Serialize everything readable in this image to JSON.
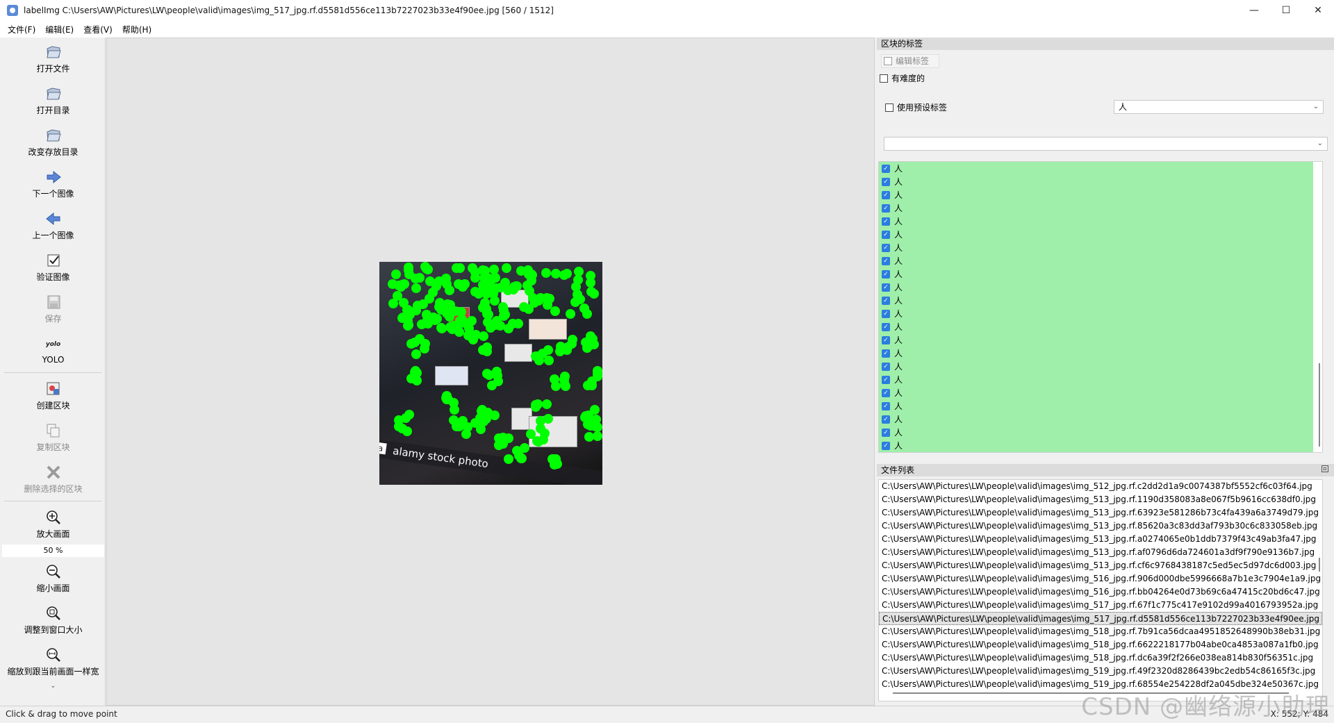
{
  "window": {
    "title": "labelImg C:\\Users\\AW\\Pictures\\LW\\people\\valid\\images\\img_517_jpg.rf.d5581d556ce113b7227023b33e4f90ee.jpg [560 / 1512]",
    "controls": {
      "minimize": "—",
      "maximize": "☐",
      "close": "✕"
    }
  },
  "menu": [
    "文件(F)",
    "编辑(E)",
    "查看(V)",
    "帮助(H)"
  ],
  "toolbar": {
    "open_file": "打开文件",
    "open_dir": "打开目录",
    "change_save_dir": "改变存放目录",
    "next_image": "下一个图像",
    "prev_image": "上一个图像",
    "verify_image": "验证图像",
    "save": "保存",
    "format_icon": "yolo",
    "format": "YOLO",
    "create_box": "创建区块",
    "duplicate_box": "复制区块",
    "delete_box": "删除选择的区块",
    "zoom_in": "放大画面",
    "zoom_value": "50 %",
    "zoom_out": "缩小画面",
    "fit_window": "调整到窗口大小",
    "fit_width": "缩放到跟当前画面一样宽",
    "more": "⌄"
  },
  "canvas": {
    "watermark_mark": "a",
    "watermark_text": "alamy stock photo"
  },
  "box_labels_dock": {
    "title": "区块的标签",
    "edit_label": "编辑标签",
    "difficult": "有难度的",
    "use_default_label": "使用预设标签",
    "default_label_value": "人",
    "label_filter_value": "",
    "label_items": [
      "人",
      "人",
      "人",
      "人",
      "人",
      "人",
      "人",
      "人",
      "人",
      "人",
      "人",
      "人",
      "人",
      "人",
      "人",
      "人",
      "人",
      "人",
      "人",
      "人",
      "人",
      "人"
    ]
  },
  "file_list_dock": {
    "title": "文件列表",
    "files": [
      "C:\\Users\\AW\\Pictures\\LW\\people\\valid\\images\\img_512_jpg.rf.c2dd2d1a9c0074387bf5552cf6c03f64.jpg",
      "C:\\Users\\AW\\Pictures\\LW\\people\\valid\\images\\img_513_jpg.rf.1190d358083a8e067f5b9616cc638df0.jpg",
      "C:\\Users\\AW\\Pictures\\LW\\people\\valid\\images\\img_513_jpg.rf.63923e581286b73c4fa439a6a3749d79.jpg",
      "C:\\Users\\AW\\Pictures\\LW\\people\\valid\\images\\img_513_jpg.rf.85620a3c83dd3af793b30c6c833058eb.jpg",
      "C:\\Users\\AW\\Pictures\\LW\\people\\valid\\images\\img_513_jpg.rf.a0274065e0b1ddb7379f43c49ab3fa47.jpg",
      "C:\\Users\\AW\\Pictures\\LW\\people\\valid\\images\\img_513_jpg.rf.af0796d6da724601a3df9f790e9136b7.jpg",
      "C:\\Users\\AW\\Pictures\\LW\\people\\valid\\images\\img_513_jpg.rf.cf6c9768438187c5ed5ec5d97dc6d003.jpg",
      "C:\\Users\\AW\\Pictures\\LW\\people\\valid\\images\\img_516_jpg.rf.906d000dbe5996668a7b1e3c7904e1a9.jpg",
      "C:\\Users\\AW\\Pictures\\LW\\people\\valid\\images\\img_516_jpg.rf.bb04264e0d73b69c6a47415c20bd6c47.jpg",
      "C:\\Users\\AW\\Pictures\\LW\\people\\valid\\images\\img_517_jpg.rf.67f1c775c417e9102d99a4016793952a.jpg",
      "C:\\Users\\AW\\Pictures\\LW\\people\\valid\\images\\img_517_jpg.rf.d5581d556ce113b7227023b33e4f90ee.jpg",
      "C:\\Users\\AW\\Pictures\\LW\\people\\valid\\images\\img_518_jpg.rf.7b91ca56dcaa4951852648990b38eb31.jpg",
      "C:\\Users\\AW\\Pictures\\LW\\people\\valid\\images\\img_518_jpg.rf.6622218177b04abe0ca4853a087a1fb0.jpg",
      "C:\\Users\\AW\\Pictures\\LW\\people\\valid\\images\\img_518_jpg.rf.dc6a39f2f266e038ea814b830f56351c.jpg",
      "C:\\Users\\AW\\Pictures\\LW\\people\\valid\\images\\img_519_jpg.rf.49f2320d8286439bc2edb54c86165f3c.jpg",
      "C:\\Users\\AW\\Pictures\\LW\\people\\valid\\images\\img_519_jpg.rf.68554e254228df2a045dbe324e50367c.jpg"
    ],
    "selected_index": 10
  },
  "status": {
    "hint": "Click & drag to move point",
    "coords": "X: 552; Y: 484"
  },
  "overlay_watermark": "CSDN @幽络源小助理",
  "colors": {
    "annotation_point": "#00ff00",
    "label_list_bg": "#9fefaa",
    "checkbox_blue": "#2b7de0"
  }
}
